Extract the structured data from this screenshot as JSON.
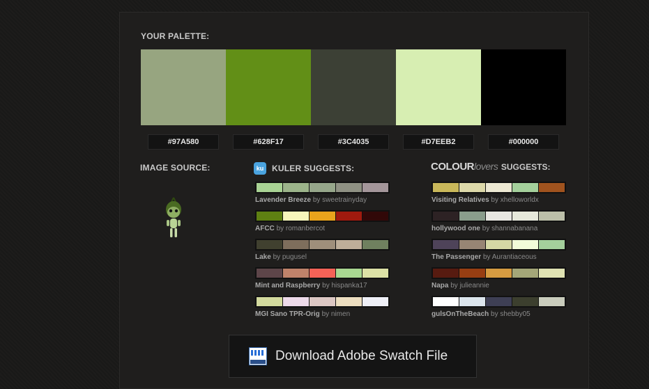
{
  "palette": {
    "heading": "YOUR PALETTE:",
    "swatches": [
      {
        "hex": "#97A580",
        "color": "#97A580"
      },
      {
        "hex": "#628F17",
        "color": "#628F17"
      },
      {
        "hex": "#3C4035",
        "color": "#3C4035"
      },
      {
        "hex": "#D7EEB2",
        "color": "#D7EEB2"
      },
      {
        "hex": "#000000",
        "color": "#000000"
      }
    ]
  },
  "image_source": {
    "heading": "IMAGE SOURCE:",
    "icon": "alien-sprite-icon"
  },
  "kuler": {
    "icon_text": "ku",
    "heading": "KULER SUGGESTS:",
    "items": [
      {
        "name": "Lavender Breeze",
        "by": "by sweetrainyday",
        "colors": [
          "#A9D394",
          "#9CB48A",
          "#96A68A",
          "#8F9183",
          "#A4969A"
        ]
      },
      {
        "name": "AFCC",
        "by": "by romanbercot",
        "colors": [
          "#5E8012",
          "#F7F6BB",
          "#E9A31C",
          "#A01A0E",
          "#310808"
        ]
      },
      {
        "name": "Lake",
        "by": "by pugusel",
        "colors": [
          "#40402F",
          "#7E6E5C",
          "#9F8F7B",
          "#BEAE99",
          "#6F805F"
        ]
      },
      {
        "name": "Mint and Raspberry",
        "by": "by hispanka17",
        "colors": [
          "#5D4549",
          "#BF826A",
          "#F56257",
          "#A9D791",
          "#DCE1A6"
        ]
      },
      {
        "name": "MGI Sano TPR-Orig",
        "by": "by nimen",
        "colors": [
          "#D3DA9E",
          "#EDDAE9",
          "#DCC7C3",
          "#ECDEC0",
          "#EEEFF6"
        ]
      }
    ]
  },
  "colourlovers": {
    "brand_bold": "COLOUR",
    "brand_italic": "lovers",
    "heading": "SUGGESTS:",
    "items": [
      {
        "name": "Visiting Relatives",
        "by": "by xhelloworldx",
        "colors": [
          "#C9B85A",
          "#DDD9A9",
          "#ECE8D2",
          "#A4D09B",
          "#A0531E"
        ]
      },
      {
        "name": "hollywood one",
        "by": "by shannabanana",
        "colors": [
          "#2D2224",
          "#8A9D8C",
          "#E7E6E1",
          "#E6E8DB",
          "#BCBFA9"
        ]
      },
      {
        "name": "The Passenger",
        "by": "by Aurantiaceous",
        "colors": [
          "#4E4359",
          "#978574",
          "#D5D8A5",
          "#F2FCD9",
          "#A4CF9C"
        ]
      },
      {
        "name": "Napa",
        "by": "by julieannie",
        "colors": [
          "#571B10",
          "#973E12",
          "#D59B41",
          "#A4A778",
          "#DFE2B2"
        ]
      },
      {
        "name": "gulsOnTheBeach",
        "by": "by shebby05",
        "colors": [
          "#FFFFFF",
          "#DCE5EC",
          "#3E3F54",
          "#3C3F2E",
          "#C9CCBC"
        ]
      }
    ]
  },
  "download": {
    "label": "Download Adobe Swatch File",
    "icon": "swatch-file-icon"
  }
}
